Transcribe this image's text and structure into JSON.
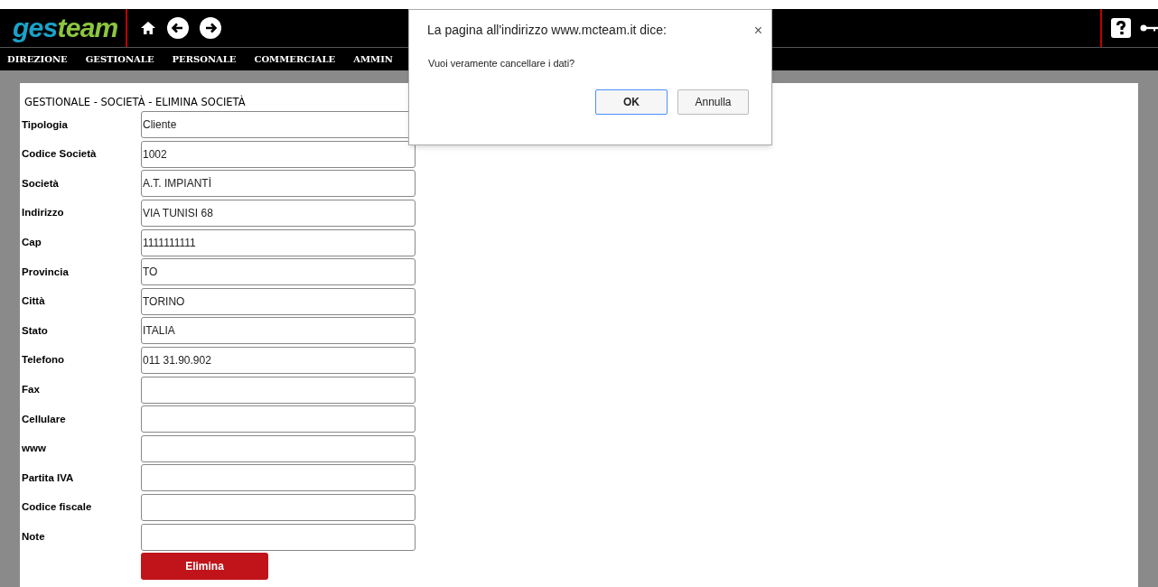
{
  "header": {
    "logo": {
      "part_1": "ges",
      "part_2": "team"
    }
  },
  "nav": {
    "items": [
      "DIREZIONE",
      "GESTIONALE",
      "PERSONALE",
      "COMMERCIALE",
      "AMMIN"
    ]
  },
  "form": {
    "title": "GESTIONALE - SOCIETÀ - ELIMINA SOCIETÀ",
    "fields": [
      {
        "label": "Tipologia",
        "value": "Cliente"
      },
      {
        "label": "Codice Società",
        "value": "1002"
      },
      {
        "label": "Società",
        "value": "A.T. IMPIANTÌ"
      },
      {
        "label": "Indirizzo",
        "value": "VIA TUNISI 68"
      },
      {
        "label": "Cap",
        "value": "1111111111"
      },
      {
        "label": "Provincia",
        "value": "TO"
      },
      {
        "label": "Città",
        "value": "TORINO"
      },
      {
        "label": "Stato",
        "value": "ITALIA"
      },
      {
        "label": "Telefono",
        "value": "011 31.90.902"
      },
      {
        "label": "Fax"
      },
      {
        "label": "Cellulare"
      },
      {
        "label": "www"
      },
      {
        "label": "Partita IVA"
      },
      {
        "label": "Codice fiscale"
      },
      {
        "label": "Note"
      }
    ],
    "submit": "Elimina"
  },
  "dialog": {
    "title": "La pagina all'indirizzo www.mcteam.it dice:",
    "close": "×",
    "message": "Vuoi veramente cancellare i dati?",
    "buttons": [
      {
        "label": "OK",
        "selected": true
      },
      {
        "label": "Annulla",
        "selected": false
      }
    ]
  }
}
